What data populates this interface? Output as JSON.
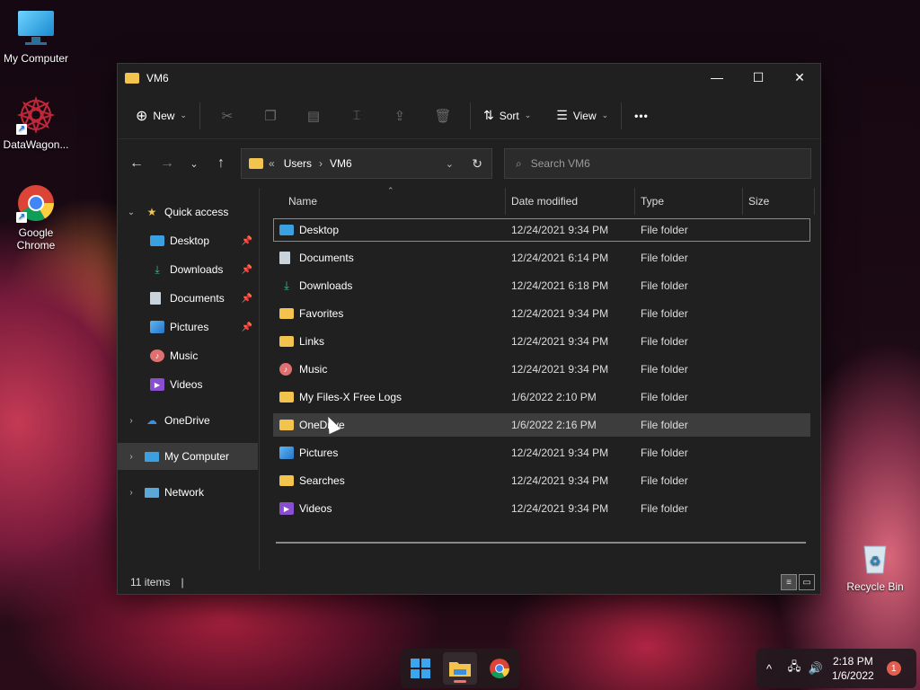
{
  "desktop": {
    "icons": [
      {
        "label": "My Computer"
      },
      {
        "label": "DataWagon..."
      },
      {
        "label": "Google Chrome"
      },
      {
        "label": "Recycle Bin"
      }
    ]
  },
  "window": {
    "title": "VM6",
    "controls": {
      "minimize": "—",
      "maximize": "☐",
      "close": "✕"
    }
  },
  "toolbar": {
    "new_label": "New",
    "sort_label": "Sort",
    "view_label": "View",
    "more": "•••"
  },
  "address": {
    "prefix": "«",
    "crumbs": [
      "Users",
      "VM6"
    ],
    "separator": "›"
  },
  "search": {
    "placeholder": "Search VM6"
  },
  "navpane": {
    "quick_access": "Quick access",
    "items": [
      {
        "label": "Desktop",
        "pinned": true
      },
      {
        "label": "Downloads",
        "pinned": true
      },
      {
        "label": "Documents",
        "pinned": true
      },
      {
        "label": "Pictures",
        "pinned": true
      },
      {
        "label": "Music",
        "pinned": false
      },
      {
        "label": "Videos",
        "pinned": false
      }
    ],
    "onedrive": "OneDrive",
    "mycomputer": "My Computer",
    "network": "Network"
  },
  "columns": {
    "name": "Name",
    "date": "Date modified",
    "type": "Type",
    "size": "Size"
  },
  "files": [
    {
      "name": "Desktop",
      "date": "12/24/2021 9:34 PM",
      "type": "File folder",
      "icon": "desktop-icon"
    },
    {
      "name": "Documents",
      "date": "12/24/2021 6:14 PM",
      "type": "File folder",
      "icon": "documents-icon"
    },
    {
      "name": "Downloads",
      "date": "12/24/2021 6:18 PM",
      "type": "File folder",
      "icon": "downloads-icon"
    },
    {
      "name": "Favorites",
      "date": "12/24/2021 9:34 PM",
      "type": "File folder",
      "icon": "folder-icon"
    },
    {
      "name": "Links",
      "date": "12/24/2021 9:34 PM",
      "type": "File folder",
      "icon": "folder-icon"
    },
    {
      "name": "Music",
      "date": "12/24/2021 9:34 PM",
      "type": "File folder",
      "icon": "music-icon"
    },
    {
      "name": "My Files-X Free Logs",
      "date": "1/6/2022 2:10 PM",
      "type": "File folder",
      "icon": "folder-icon"
    },
    {
      "name": "OneDrive",
      "date": "1/6/2022 2:16 PM",
      "type": "File folder",
      "icon": "folder-icon"
    },
    {
      "name": "Pictures",
      "date": "12/24/2021 9:34 PM",
      "type": "File folder",
      "icon": "pictures-icon"
    },
    {
      "name": "Searches",
      "date": "12/24/2021 9:34 PM",
      "type": "File folder",
      "icon": "folder-icon"
    },
    {
      "name": "Videos",
      "date": "12/24/2021 9:34 PM",
      "type": "File folder",
      "icon": "videos-icon"
    }
  ],
  "status": {
    "items_count": "11 items"
  },
  "taskbar": {
    "time": "2:18 PM",
    "date": "1/6/2022",
    "notification_count": "1"
  }
}
